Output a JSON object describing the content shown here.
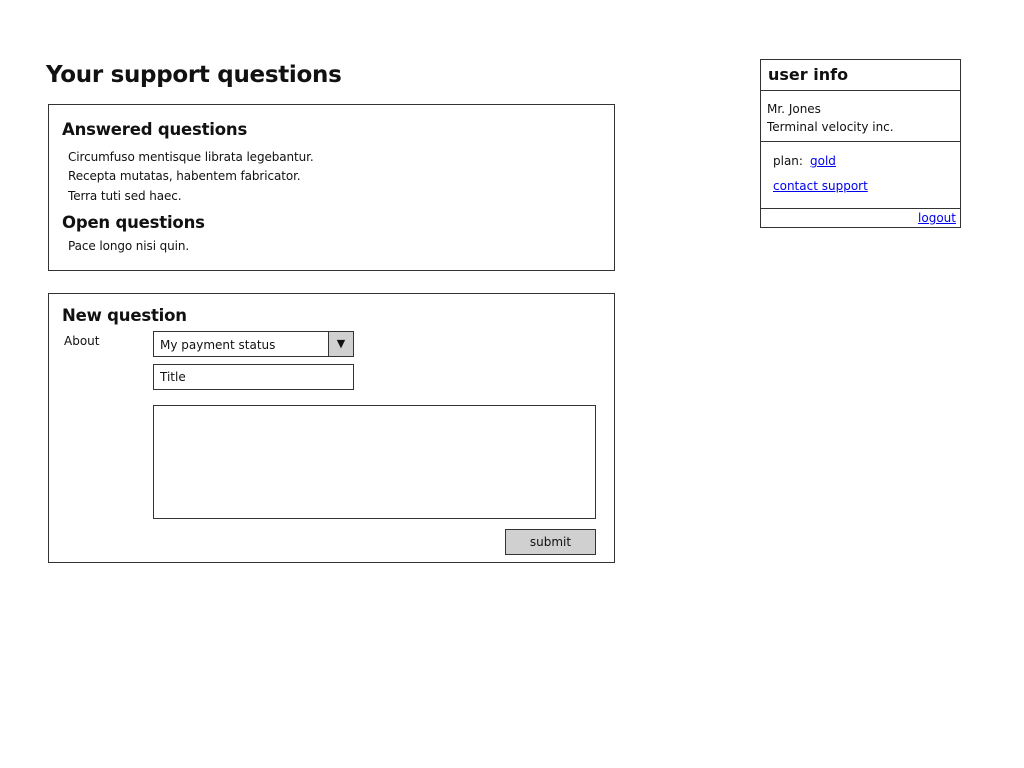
{
  "page": {
    "title": "Your support questions"
  },
  "answered": {
    "heading": "Answered questions",
    "items": [
      "Circumfuso  mentisque librata legebantur.",
      "Recepta mutatas, habentem fabricator.",
      "Terra  tuti sed haec."
    ]
  },
  "open": {
    "heading": "Open questions",
    "items": [
      "Pace  longo nisi quin."
    ]
  },
  "new_question": {
    "heading": "New question",
    "about_label": "About",
    "about_selected": "My payment status",
    "dropdown_arrow": "▼",
    "title_placeholder": "Title",
    "body_value": "",
    "submit_label": "submit"
  },
  "user_info": {
    "heading": "user info",
    "name": "Mr. Jones",
    "company": "Terminal velocity inc.",
    "plan_label": "plan:",
    "plan_value": "gold",
    "contact_link": "contact support",
    "logout_link": "logout",
    "link_color": "#0000ee"
  },
  "colors": {
    "border": "#333333",
    "button_bg": "#d0d0d0",
    "background": "#ffffff"
  }
}
